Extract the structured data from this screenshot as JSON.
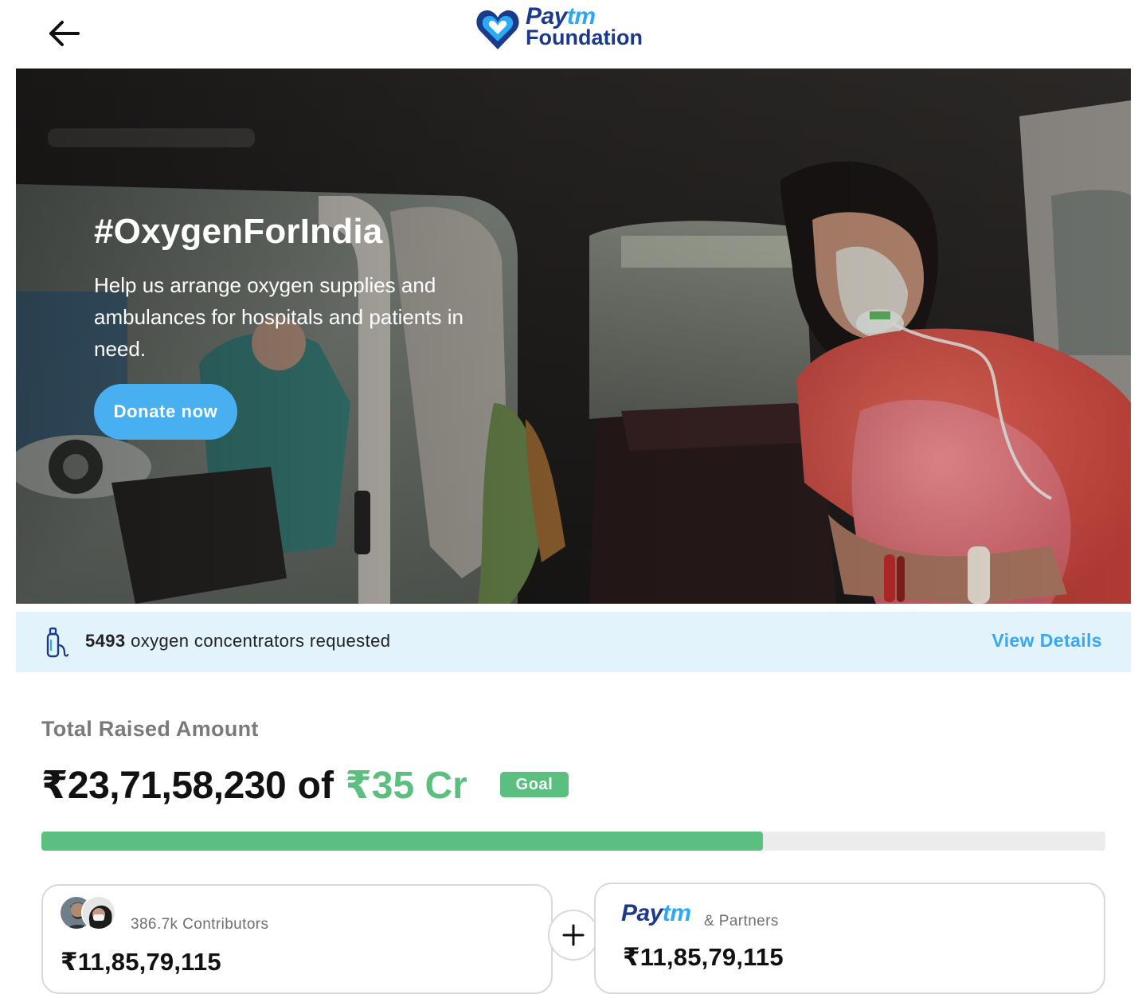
{
  "header": {
    "back_icon": "arrow-left-icon",
    "brand": {
      "pay": "Pay",
      "tm": "tm",
      "foundation": "Foundation"
    }
  },
  "hero": {
    "title": "#OxygenForIndia",
    "description": "Help us arrange oxygen supplies and ambulances for hospitals and patients in need.",
    "cta_label": "Donate now"
  },
  "info_strip": {
    "icon": "oxygen-cylinder-icon",
    "count": "5493",
    "text": "oxygen concentrators requested",
    "link_label": "View Details"
  },
  "raised": {
    "label": "Total Raised Amount",
    "amount": "₹23,71,58,230",
    "of_text": "of",
    "goal_amount": "₹35 Cr",
    "goal_badge": "Goal",
    "progress_fraction": 0.678
  },
  "contributors_card": {
    "label": "386.7k Contributors",
    "amount": "₹11,85,79,115"
  },
  "partners_card": {
    "logo_pay": "Pay",
    "logo_tm": "tm",
    "label": "& Partners",
    "amount": "₹11,85,79,115"
  },
  "colors": {
    "accent_blue": "#48b0f0",
    "goal_green": "#5bbf7f",
    "brand_navy": "#1b3a8c",
    "strip_bg": "#e3f3fc"
  }
}
